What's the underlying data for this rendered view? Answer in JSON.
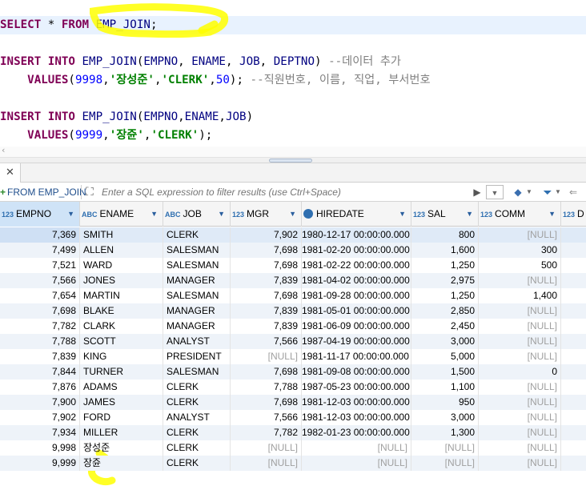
{
  "editor": {
    "lines": [
      {
        "tokens": [
          {
            "t": "SELECT",
            "c": "kw"
          },
          {
            "t": " * ",
            "c": "pn"
          },
          {
            "t": "FROM",
            "c": "kw"
          },
          {
            "t": " ",
            "c": "pn"
          },
          {
            "t": "EMP_JOIN",
            "c": "id"
          },
          {
            "t": ";",
            "c": "pn"
          }
        ]
      },
      {
        "tokens": []
      },
      {
        "tokens": [
          {
            "t": "INSERT",
            "c": "kw"
          },
          {
            "t": " ",
            "c": "pn"
          },
          {
            "t": "INTO",
            "c": "kw"
          },
          {
            "t": " ",
            "c": "pn"
          },
          {
            "t": "EMP_JOIN",
            "c": "id"
          },
          {
            "t": "(",
            "c": "pn"
          },
          {
            "t": "EMPNO",
            "c": "id"
          },
          {
            "t": ", ",
            "c": "pn"
          },
          {
            "t": "ENAME",
            "c": "id"
          },
          {
            "t": ", ",
            "c": "pn"
          },
          {
            "t": "JOB",
            "c": "id"
          },
          {
            "t": ", ",
            "c": "pn"
          },
          {
            "t": "DEPTNO",
            "c": "id"
          },
          {
            "t": ") ",
            "c": "pn"
          },
          {
            "t": "--데이터 추가",
            "c": "cmt"
          }
        ]
      },
      {
        "tokens": [
          {
            "t": "    ",
            "c": "pn"
          },
          {
            "t": "VALUES",
            "c": "kw"
          },
          {
            "t": "(",
            "c": "pn"
          },
          {
            "t": "9998",
            "c": "num"
          },
          {
            "t": ",",
            "c": "pn"
          },
          {
            "t": "'장성준'",
            "c": "str"
          },
          {
            "t": ",",
            "c": "pn"
          },
          {
            "t": "'CLERK'",
            "c": "str"
          },
          {
            "t": ",",
            "c": "pn"
          },
          {
            "t": "50",
            "c": "num"
          },
          {
            "t": "); ",
            "c": "pn"
          },
          {
            "t": "--직원번호, 이름, 직업, 부서번호",
            "c": "cmt"
          }
        ]
      },
      {
        "tokens": []
      },
      {
        "tokens": [
          {
            "t": "INSERT",
            "c": "kw"
          },
          {
            "t": " ",
            "c": "pn"
          },
          {
            "t": "INTO",
            "c": "kw"
          },
          {
            "t": " ",
            "c": "pn"
          },
          {
            "t": "EMP_JOIN",
            "c": "id"
          },
          {
            "t": "(",
            "c": "pn"
          },
          {
            "t": "EMPNO",
            "c": "id"
          },
          {
            "t": ",",
            "c": "pn"
          },
          {
            "t": "ENAME",
            "c": "id"
          },
          {
            "t": ",",
            "c": "pn"
          },
          {
            "t": "JOB",
            "c": "id"
          },
          {
            "t": ")",
            "c": "pn"
          }
        ]
      },
      {
        "tokens": [
          {
            "t": "    ",
            "c": "pn"
          },
          {
            "t": "VALUES",
            "c": "kw"
          },
          {
            "t": "(",
            "c": "pn"
          },
          {
            "t": "9999",
            "c": "num"
          },
          {
            "t": ",",
            "c": "pn"
          },
          {
            "t": "'장쥰'",
            "c": "str"
          },
          {
            "t": ",",
            "c": "pn"
          },
          {
            "t": "'CLERK'",
            "c": "str"
          },
          {
            "t": ");",
            "c": "pn"
          }
        ]
      }
    ]
  },
  "results": {
    "tab_close": "✕",
    "filter_source": "FROM EMP_JOIN",
    "filter_placeholder": "Enter a SQL expression to filter results (use Ctrl+Space)",
    "columns": [
      {
        "type": "123",
        "name": "EMPNO"
      },
      {
        "type": "ABC",
        "name": "ENAME"
      },
      {
        "type": "ABC",
        "name": "JOB"
      },
      {
        "type": "123",
        "name": "MGR"
      },
      {
        "type": "clock",
        "name": "HIREDATE"
      },
      {
        "type": "123",
        "name": "SAL"
      },
      {
        "type": "123",
        "name": "COMM"
      },
      {
        "type": "123",
        "name": "D"
      }
    ],
    "null_text": "[NULL]",
    "rows": [
      [
        "7,369",
        "SMITH",
        "CLERK",
        "7,902",
        "1980-12-17 00:00:00.000",
        "800",
        "[NULL]"
      ],
      [
        "7,499",
        "ALLEN",
        "SALESMAN",
        "7,698",
        "1981-02-20 00:00:00.000",
        "1,600",
        "300"
      ],
      [
        "7,521",
        "WARD",
        "SALESMAN",
        "7,698",
        "1981-02-22 00:00:00.000",
        "1,250",
        "500"
      ],
      [
        "7,566",
        "JONES",
        "MANAGER",
        "7,839",
        "1981-04-02 00:00:00.000",
        "2,975",
        "[NULL]"
      ],
      [
        "7,654",
        "MARTIN",
        "SALESMAN",
        "7,698",
        "1981-09-28 00:00:00.000",
        "1,250",
        "1,400"
      ],
      [
        "7,698",
        "BLAKE",
        "MANAGER",
        "7,839",
        "1981-05-01 00:00:00.000",
        "2,850",
        "[NULL]"
      ],
      [
        "7,782",
        "CLARK",
        "MANAGER",
        "7,839",
        "1981-06-09 00:00:00.000",
        "2,450",
        "[NULL]"
      ],
      [
        "7,788",
        "SCOTT",
        "ANALYST",
        "7,566",
        "1987-04-19 00:00:00.000",
        "3,000",
        "[NULL]"
      ],
      [
        "7,839",
        "KING",
        "PRESIDENT",
        "[NULL]",
        "1981-11-17 00:00:00.000",
        "5,000",
        "[NULL]"
      ],
      [
        "7,844",
        "TURNER",
        "SALESMAN",
        "7,698",
        "1981-09-08 00:00:00.000",
        "1,500",
        "0"
      ],
      [
        "7,876",
        "ADAMS",
        "CLERK",
        "7,788",
        "1987-05-23 00:00:00.000",
        "1,100",
        "[NULL]"
      ],
      [
        "7,900",
        "JAMES",
        "CLERK",
        "7,698",
        "1981-12-03 00:00:00.000",
        "950",
        "[NULL]"
      ],
      [
        "7,902",
        "FORD",
        "ANALYST",
        "7,566",
        "1981-12-03 00:00:00.000",
        "3,000",
        "[NULL]"
      ],
      [
        "7,934",
        "MILLER",
        "CLERK",
        "7,782",
        "1982-01-23 00:00:00.000",
        "1,300",
        "[NULL]"
      ],
      [
        "9,998",
        "장성준",
        "CLERK",
        "[NULL]",
        "[NULL]",
        "[NULL]",
        "[NULL]"
      ],
      [
        "9,999",
        "장쥰",
        "CLERK",
        "[NULL]",
        "[NULL]",
        "[NULL]",
        "[NULL]"
      ]
    ]
  },
  "colors": {
    "keyword": "#7f0055",
    "identifier": "#000080",
    "number": "#0000ff",
    "string": "#008000",
    "comment": "#808080",
    "highlighter": "#ffff00"
  }
}
